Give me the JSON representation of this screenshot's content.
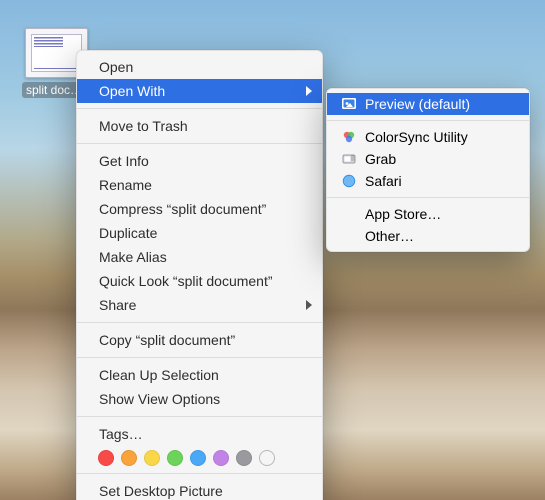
{
  "desktop_file": {
    "label": "split document"
  },
  "context_menu": {
    "open": "Open",
    "open_with": "Open With",
    "move_to_trash": "Move to Trash",
    "get_info": "Get Info",
    "rename": "Rename",
    "compress": "Compress “split document”",
    "duplicate": "Duplicate",
    "make_alias": "Make Alias",
    "quick_look": "Quick Look “split document”",
    "share": "Share",
    "copy": "Copy “split document”",
    "clean_up": "Clean Up Selection",
    "view_options": "Show View Options",
    "tags_label": "Tags…",
    "set_desktop": "Set Desktop Picture"
  },
  "tag_colors": [
    "#f84b48",
    "#f9a33b",
    "#f9d748",
    "#6cd45a",
    "#4aa8f7",
    "#c184e6",
    "#9a9a9e"
  ],
  "open_with_menu": {
    "preview": "Preview (default)",
    "colorsync": "ColorSync Utility",
    "grab": "Grab",
    "safari": "Safari",
    "app_store": "App Store…",
    "other": "Other…"
  }
}
